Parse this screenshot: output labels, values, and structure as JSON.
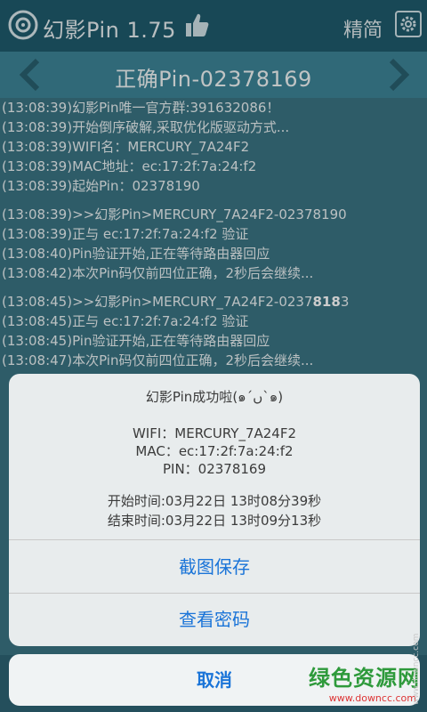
{
  "app": {
    "title": "幻影Pin 1.75",
    "lang_label": "精简"
  },
  "header": {
    "pin_title": "正确Pin-02378169"
  },
  "log": [
    "(13:08:39)幻影Pin唯一官方群:391632086！",
    "(13:08:39)开始倒序破解,采取优化版驱动方式...",
    "(13:08:39)WIFI名：MERCURY_7A24F2",
    "(13:08:39)MAC地址：ec:17:2f:7a:24:f2",
    "(13:08:39)起始Pin：02378190",
    "",
    "(13:08:39)>>幻影Pin>MERCURY_7A24F2-0237",
    "(13:08:39)正与 ec:17:2f:7a:24:f2 验证",
    "(13:08:40)Pin验证开始,正在等待路由器回应",
    "(13:08:42)本次Pin码仅前四位正确，2秒后会继续...",
    "",
    "(13:08:45)>>幻影Pin>MERCURY_7A24F2-0237",
    "(13:08:45)正与 ec:17:2f:7a:24:f2 验证",
    "(13:08:45)Pin验证开始,正在等待路由器回应",
    "(13:08:47)本次Pin码仅前四位正确，2秒后会继续..."
  ],
  "log_suffix": {
    "line7_bold": "0237",
    "line7_tail": "8190",
    "line12_plain": "0237",
    "line12_bold": "818",
    "line12_tail": "3"
  },
  "dialog": {
    "title": "幻影Pin成功啦(๑´ں`๑)",
    "wifi": "WIFI：MERCURY_7A24F2",
    "mac": "MAC：ec:17:2f:7a:24:f2",
    "pin": "PIN：02378169",
    "start": "开始时间:03月22日 13时08分39秒",
    "end": "结束时间:03月22日 13时09分13秒",
    "btn_save": "截图保存",
    "btn_view": "查看密码",
    "btn_cancel": "取消"
  },
  "watermark": {
    "main": "绿色资源网",
    "url": "www.downcc.com",
    "side": "www.downcc.com"
  },
  "colors": {
    "accent": "#1a74d8",
    "bg": "#3a7383",
    "topbar": "#1f5a6c"
  }
}
